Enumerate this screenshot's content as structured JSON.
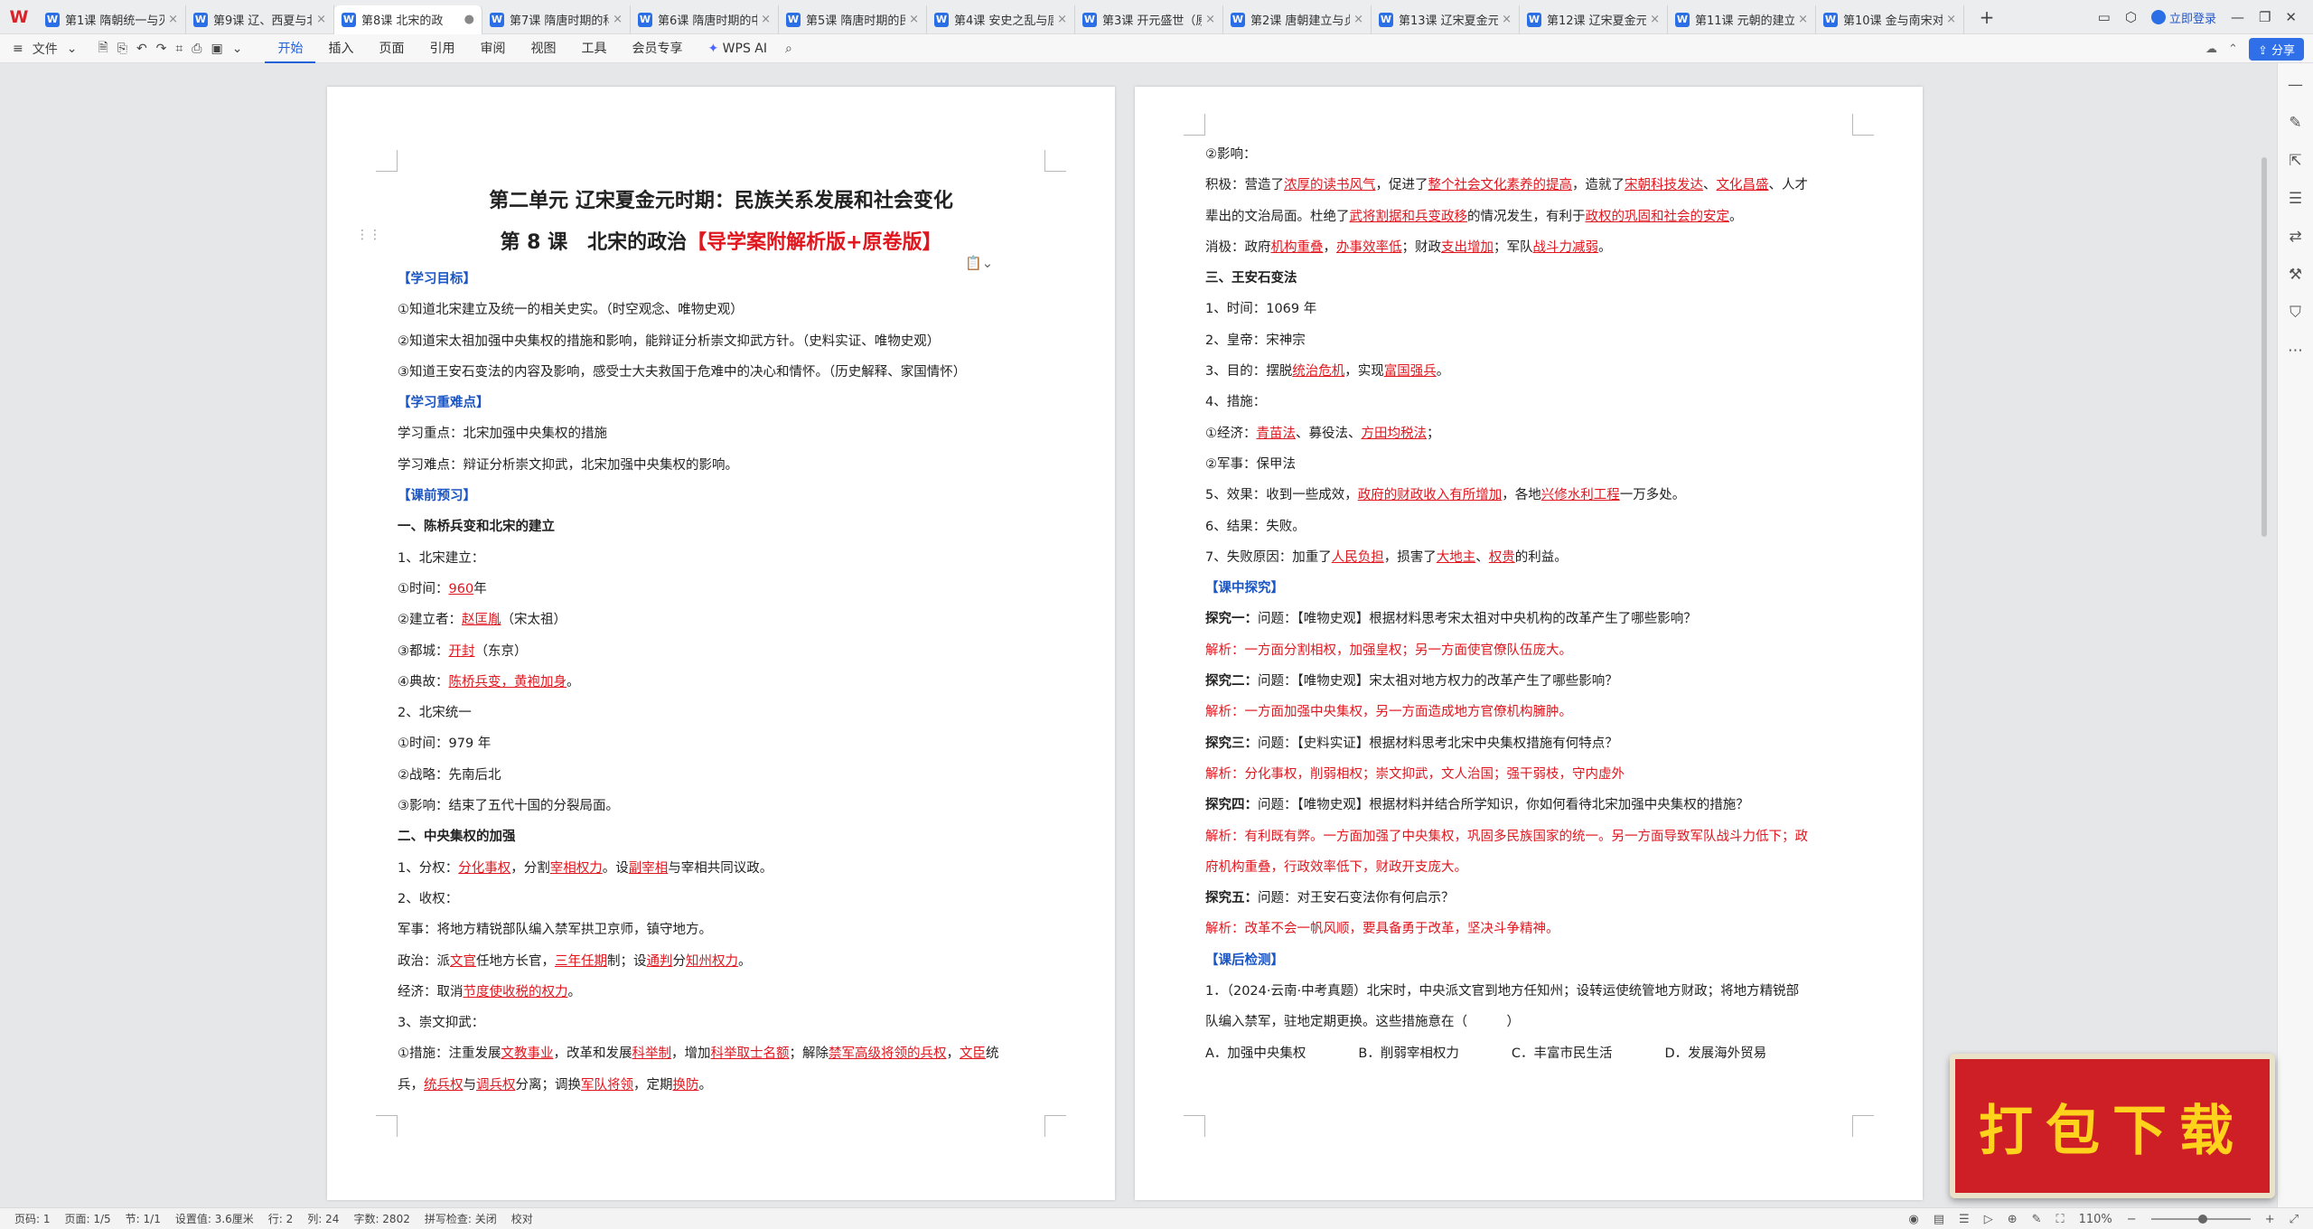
{
  "tabs": [
    {
      "label": "第1课 隋朝统一与灭",
      "active": false
    },
    {
      "label": "第9课 辽、西夏与北",
      "active": false
    },
    {
      "label": "第8课 北宋的政",
      "active": true
    },
    {
      "label": "第7课 隋唐时期的科",
      "active": false
    },
    {
      "label": "第6课 隋唐时期的中",
      "active": false
    },
    {
      "label": "第5课 隋唐时期的民",
      "active": false
    },
    {
      "label": "第4课 安史之乱与唐",
      "active": false
    },
    {
      "label": "第3课 开元盛世（原",
      "active": false
    },
    {
      "label": "第2课 唐朝建立与贞",
      "active": false
    },
    {
      "label": "第13课 辽宋夏金元",
      "active": false
    },
    {
      "label": "第12课 辽宋夏金元",
      "active": false
    },
    {
      "label": "第11课 元朝的建立",
      "active": false
    },
    {
      "label": "第10课 金与南宋对",
      "active": false
    }
  ],
  "topbar": {
    "login": "立即登录"
  },
  "ribbon": {
    "file": "文件",
    "menus": [
      "开始",
      "插入",
      "页面",
      "引用",
      "审阅",
      "视图",
      "工具",
      "会员专享"
    ],
    "active_menu": "开始",
    "wps_ai": "WPS AI",
    "share": "分享"
  },
  "page1": {
    "lines": [
      [
        {
          "t": "第二单元 辽宋夏金元时期：民族关系发展和社会变化"
        }
      ],
      [
        {
          "t": "第 8 课　北宋的政治"
        },
        {
          "t": "【导学案附解析版+原卷版】",
          "s": "red"
        }
      ],
      [
        {
          "t": "【学习目标】",
          "s": "sec"
        }
      ],
      [
        {
          "t": "①知道北宋建立及统一的相关史实。（时空观念、唯物史观）"
        }
      ],
      [
        {
          "t": "②知道宋太祖加强中央集权的措施和影响，能辩证分析崇文抑武方针。（史料实证、唯物史观）"
        }
      ],
      [
        {
          "t": "③知道王安石变法的内容及影响，感受士大夫救国于危难中的决心和情怀。（历史解释、家国情怀）"
        }
      ],
      [
        {
          "t": "【学习重难点】",
          "s": "sec"
        }
      ],
      [
        {
          "t": "学习重点：北宋加强中央集权的措施"
        }
      ],
      [
        {
          "t": "学习难点：辩证分析崇文抑武，北宋加强中央集权的影响。"
        }
      ],
      [
        {
          "t": "【课前预习】",
          "s": "sec"
        }
      ],
      [
        {
          "t": "一、陈桥兵变和北宋的建立",
          "s": "b"
        }
      ],
      [
        {
          "t": "1、北宋建立："
        }
      ],
      [
        {
          "t": "①时间："
        },
        {
          "t": "960",
          "s": "u"
        },
        {
          "t": "年"
        }
      ],
      [
        {
          "t": "②建立者："
        },
        {
          "t": "赵匡胤",
          "s": "u"
        },
        {
          "t": "（宋太祖）"
        }
      ],
      [
        {
          "t": "③都城："
        },
        {
          "t": "开封",
          "s": "u"
        },
        {
          "t": "（东京）"
        }
      ],
      [
        {
          "t": "④典故："
        },
        {
          "t": "陈桥兵变，黄袍加身",
          "s": "u"
        },
        {
          "t": "。"
        }
      ],
      [
        {
          "t": "2、北宋统一"
        }
      ],
      [
        {
          "t": "①时间：979 年"
        }
      ],
      [
        {
          "t": "②战略：先南后北"
        }
      ],
      [
        {
          "t": "③影响：结束了五代十国的分裂局面。"
        }
      ],
      [
        {
          "t": "二、中央集权的加强",
          "s": "b"
        }
      ],
      [
        {
          "t": "1、分权："
        },
        {
          "t": "分化事权",
          "s": "u"
        },
        {
          "t": "，分割"
        },
        {
          "t": "宰相权力",
          "s": "u"
        },
        {
          "t": "。设"
        },
        {
          "t": "副宰相",
          "s": "u"
        },
        {
          "t": "与宰相共同议政。"
        }
      ],
      [
        {
          "t": "2、收权："
        }
      ],
      [
        {
          "t": "军事：将地方精锐部队编入禁军拱卫京师，镇守地方。"
        }
      ],
      [
        {
          "t": "政治：派"
        },
        {
          "t": "文官",
          "s": "u"
        },
        {
          "t": "任地方长官，"
        },
        {
          "t": "三年任期",
          "s": "u"
        },
        {
          "t": "制；设"
        },
        {
          "t": "通判",
          "s": "u"
        },
        {
          "t": "分"
        },
        {
          "t": "知州权力",
          "s": "u"
        },
        {
          "t": "。"
        }
      ],
      [
        {
          "t": "经济：取消"
        },
        {
          "t": "节度使收税的权力",
          "s": "u"
        },
        {
          "t": "。"
        }
      ],
      [
        {
          "t": "3、崇文抑武："
        }
      ],
      [
        {
          "t": "①措施：注重发展"
        },
        {
          "t": "文教事业",
          "s": "u"
        },
        {
          "t": "，改革和发展"
        },
        {
          "t": "科举制",
          "s": "u"
        },
        {
          "t": "，增加"
        },
        {
          "t": "科举取士名额",
          "s": "u"
        },
        {
          "t": "；解除"
        },
        {
          "t": "禁军高级将领的兵权",
          "s": "u"
        },
        {
          "t": "，"
        },
        {
          "t": "文臣",
          "s": "u"
        },
        {
          "t": "统"
        }
      ],
      [
        {
          "t": "兵，"
        },
        {
          "t": "统兵权",
          "s": "u"
        },
        {
          "t": "与"
        },
        {
          "t": "调兵权",
          "s": "u"
        },
        {
          "t": "分离；调换"
        },
        {
          "t": "军队将领",
          "s": "u"
        },
        {
          "t": "，定期"
        },
        {
          "t": "换防",
          "s": "u"
        },
        {
          "t": "。"
        }
      ]
    ]
  },
  "page2": {
    "lines": [
      [
        {
          "t": "②影响："
        }
      ],
      [
        {
          "t": "积极：营造了"
        },
        {
          "t": "浓厚的读书风气",
          "s": "u"
        },
        {
          "t": "，促进了"
        },
        {
          "t": "整个社会文化素养的提高",
          "s": "u"
        },
        {
          "t": "，造就了"
        },
        {
          "t": "宋朝科技发达",
          "s": "u"
        },
        {
          "t": "、"
        },
        {
          "t": "文化昌盛",
          "s": "u"
        },
        {
          "t": "、人才"
        }
      ],
      [
        {
          "t": "辈出的文治局面。杜绝了"
        },
        {
          "t": "武将割据和兵变政移",
          "s": "u"
        },
        {
          "t": "的情况发生，有利于"
        },
        {
          "t": "政权的巩固和社会的安定",
          "s": "u"
        },
        {
          "t": "。"
        }
      ],
      [
        {
          "t": "消极：政府"
        },
        {
          "t": "机构重叠",
          "s": "u"
        },
        {
          "t": "，"
        },
        {
          "t": "办事效率低",
          "s": "u"
        },
        {
          "t": "；财政"
        },
        {
          "t": "支出增加",
          "s": "u"
        },
        {
          "t": "；军队"
        },
        {
          "t": "战斗力减弱",
          "s": "u"
        },
        {
          "t": "。"
        }
      ],
      [
        {
          "t": "三、王安石变法",
          "s": "b"
        }
      ],
      [
        {
          "t": "1、时间：1069 年"
        }
      ],
      [
        {
          "t": "2、皇帝：宋神宗"
        }
      ],
      [
        {
          "t": "3、目的：摆脱"
        },
        {
          "t": "统治危机",
          "s": "u"
        },
        {
          "t": "，实现"
        },
        {
          "t": "富国强兵",
          "s": "u"
        },
        {
          "t": "。"
        }
      ],
      [
        {
          "t": "4、措施："
        }
      ],
      [
        {
          "t": "①经济："
        },
        {
          "t": "青苗法",
          "s": "u"
        },
        {
          "t": "、募役法、"
        },
        {
          "t": "方田均税法",
          "s": "u"
        },
        {
          "t": "；"
        }
      ],
      [
        {
          "t": "②军事：保甲法"
        }
      ],
      [
        {
          "t": "5、效果：收到一些成效，"
        },
        {
          "t": "政府的财政收入有所增加",
          "s": "u"
        },
        {
          "t": "，各地"
        },
        {
          "t": "兴修水利工程",
          "s": "u"
        },
        {
          "t": "一万多处。"
        }
      ],
      [
        {
          "t": "6、结果：失败。"
        }
      ],
      [
        {
          "t": "7、失败原因：加重了"
        },
        {
          "t": "人民负担",
          "s": "u"
        },
        {
          "t": "，损害了"
        },
        {
          "t": "大地主",
          "s": "u"
        },
        {
          "t": "、"
        },
        {
          "t": "权贵",
          "s": "u"
        },
        {
          "t": "的利益。"
        }
      ],
      [
        {
          "t": "【课中探究】",
          "s": "sec"
        }
      ],
      [
        {
          "t": "探究一：",
          "s": "b"
        },
        {
          "t": "问题：【唯物史观】根据材料思考宋太祖对中央机构的改革产生了哪些影响？"
        }
      ],
      [
        {
          "t": "解析：一方面分割相权，加强皇权；另一方面使官僚队伍庞大。",
          "s": "ans"
        }
      ],
      [
        {
          "t": "探究二：",
          "s": "b"
        },
        {
          "t": "问题：【唯物史观】宋太祖对地方权力的改革产生了哪些影响？"
        }
      ],
      [
        {
          "t": "解析：一方面加强中央集权，另一方面造成地方官僚机构臃肿。",
          "s": "ans"
        }
      ],
      [
        {
          "t": "探究三：",
          "s": "b"
        },
        {
          "t": "问题：【史料实证】根据材料思考北宋中央集权措施有何特点？"
        }
      ],
      [
        {
          "t": "解析：分化事权，削弱相权；崇文抑武，文人治国；强干弱枝，守内虚外",
          "s": "ans"
        }
      ],
      [
        {
          "t": "探究四：",
          "s": "b"
        },
        {
          "t": "问题：【唯物史观】根据材料并结合所学知识，你如何看待北宋加强中央集权的措施？"
        }
      ],
      [
        {
          "t": "解析：有利既有弊。一方面加强了中央集权，巩固多民族国家的统一。另一方面导致军队战斗力低下；政",
          "s": "ans"
        }
      ],
      [
        {
          "t": "府机构重叠，行政效率低下，财政开支庞大。",
          "s": "ans"
        }
      ],
      [
        {
          "t": "探究五：",
          "s": "b"
        },
        {
          "t": "问题：对王安石变法你有何启示？"
        }
      ],
      [
        {
          "t": "解析：改革不会一帆风顺，要具备勇于改革，坚决斗争精神。",
          "s": "ans"
        }
      ],
      [
        {
          "t": "【课后检测】",
          "s": "sec"
        }
      ],
      [
        {
          "t": "1．（2024·云南·中考真题）北宋时，中央派文官到地方任知州；设转运使统管地方财政；将地方精锐部"
        }
      ],
      [
        {
          "t": "队编入禁军，驻地定期更换。这些措施意在（　　　）"
        }
      ],
      [
        {
          "t": "A．加强中央集权　　　　B．削弱宰相权力　　　　C．丰富市民生活　　　　D．发展海外贸易"
        }
      ]
    ]
  },
  "status": {
    "items": [
      "页码: 1",
      "页面: 1/5",
      "节: 1/1",
      "设置值: 3.6厘米",
      "行: 2",
      "列: 24",
      "字数: 2802",
      "拼写检查: 关闭",
      "校对"
    ],
    "zoom": "110%"
  },
  "promo": "打包下载"
}
